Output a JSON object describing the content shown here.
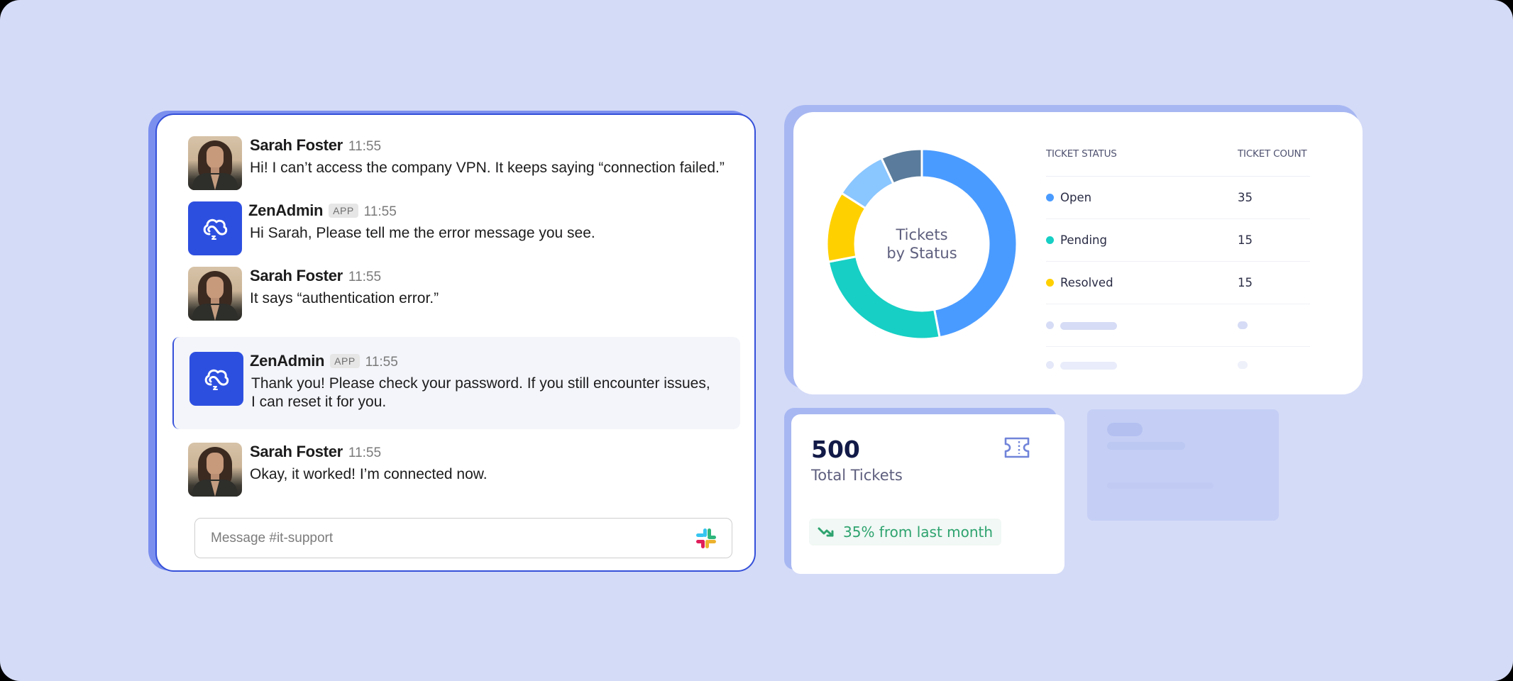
{
  "chat": {
    "messages": [
      {
        "sender": "Sarah Foster",
        "time": "11:55",
        "text": "Hi! I can’t access the company VPN. It keeps saying “connection failed.”",
        "avatar": "person-avatar"
      },
      {
        "sender": "ZenAdmin",
        "badge": "APP",
        "time": "11:55",
        "text": "Hi Sarah, Please tell me the error message you see.",
        "avatar": "zenadmin-logo-icon"
      },
      {
        "sender": "Sarah Foster",
        "time": "11:55",
        "text": "It says “authentication error.”",
        "avatar": "person-avatar"
      },
      {
        "sender": "ZenAdmin",
        "badge": "APP",
        "time": "11:55",
        "text_lines": [
          "Thank you! Please check your password. If you still encounter issues,",
          "I can reset it for you."
        ],
        "avatar": "zenadmin-logo-icon",
        "highlighted": true
      },
      {
        "sender": "Sarah Foster",
        "time": "11:55",
        "text": "Okay, it worked! I’m connected now.",
        "avatar": "person-avatar"
      }
    ],
    "composer": {
      "placeholder": "Message #it-support",
      "value": "",
      "icon": "slack-logo-icon"
    }
  },
  "status_card": {
    "center_label_line1": "Tickets",
    "center_label_line2": "by Status",
    "table": {
      "headers": [
        "TICKET STATUS",
        "TICKET COUNT"
      ],
      "rows": [
        {
          "status": "Open",
          "count": "35",
          "color": "#4A9BFF"
        },
        {
          "status": "Pending",
          "count": "15",
          "color": "#17CFC4"
        },
        {
          "status": "Resolved",
          "count": "15",
          "color": "#FFD000"
        }
      ],
      "placeholder_rows": 2
    }
  },
  "chart_data": {
    "type": "pie",
    "title": "Tickets by Status",
    "donut": true,
    "start": "top",
    "direction": "clockwise",
    "slices": [
      {
        "label": "Open",
        "value": 47,
        "color": "#4A9BFF"
      },
      {
        "label": "Pending",
        "value": 25,
        "color": "#17CFC4"
      },
      {
        "label": "Resolved",
        "value": 12,
        "color": "#FFD000"
      },
      {
        "label": "",
        "value": 9,
        "color": "#8AC6FF"
      },
      {
        "label": "",
        "value": 7,
        "color": "#5A7B9B"
      }
    ],
    "unit": "percent (approximate, read from arc angles)"
  },
  "stat_card": {
    "value": "500",
    "label": "Total Tickets",
    "icon": "ticket-icon",
    "trend": {
      "text": "35% from last month",
      "direction": "down",
      "icon": "trend-down-icon",
      "color": "#2EA36F"
    }
  },
  "colors": {
    "background": "#D4DBF7",
    "chat_border": "#3550D9",
    "brand_blue": "#2D4FE0",
    "card_shadow": "#A7B7F2"
  }
}
